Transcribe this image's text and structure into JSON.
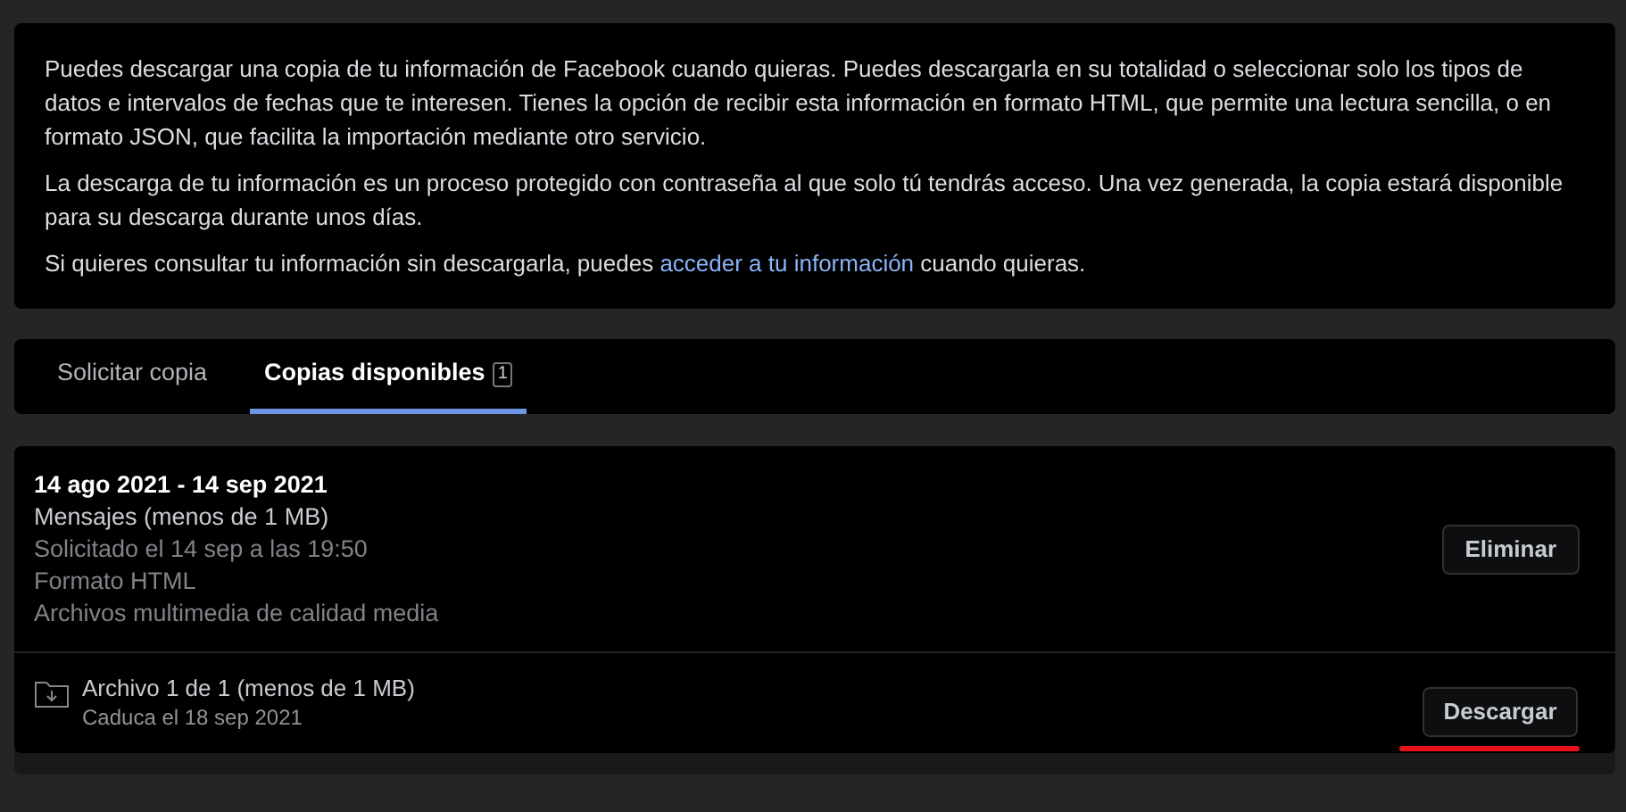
{
  "info": {
    "paragraphs": [
      {
        "text": "Puedes descargar una copia de tu información de Facebook cuando quieras. Puedes descargarla en su totalidad o seleccionar solo los tipos de datos e intervalos de fechas que te interesen. Tienes la opción de recibir esta información en formato HTML, que permite una lectura sencilla, o en formato JSON, que facilita la importación mediante otro servicio."
      },
      {
        "text": "La descarga de tu información es un proceso protegido con contraseña al que solo tú tendrás acceso. Una vez generada, la copia estará disponible para su descarga durante unos días."
      },
      {
        "text": "Si quieres consultar tu información sin descargarla, puedes ",
        "link": "acceder a tu información",
        "after": " cuando quieras."
      }
    ]
  },
  "tabs": [
    {
      "label": "Solicitar copia",
      "selected": false
    },
    {
      "label": "Copias disponibles",
      "badge": "1",
      "selected": true
    }
  ],
  "copy": {
    "title": "14 ago 2021 - 14 sep 2021",
    "content": "Mensajes (menos de 1 MB)",
    "details": [
      "Solicitado el 14 sep a las 19:50",
      "Formato HTML",
      "Archivos multimedia de calidad media"
    ],
    "delete_button": "Eliminar",
    "file": {
      "name": "Archivo 1 de 1 (menos de 1 MB)",
      "expires": "Caduca el 18 sep 2021",
      "download_button": "Descargar"
    }
  }
}
